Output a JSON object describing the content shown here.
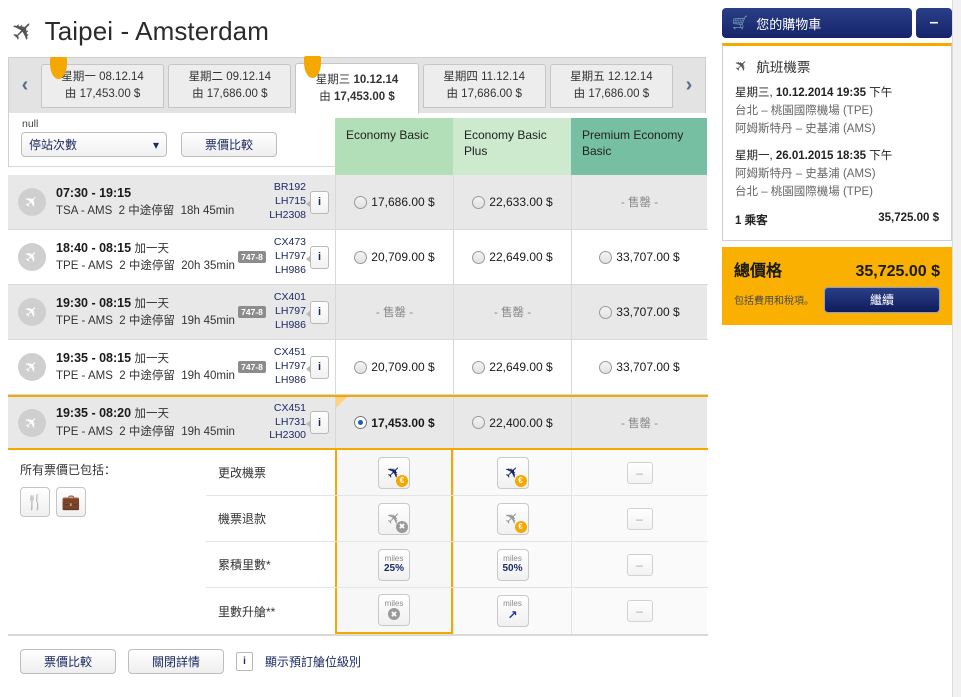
{
  "header": {
    "title": "Taipei - Amsterdam",
    "plane_icon": "airplane-icon"
  },
  "date_tabs": {
    "prev_label": "‹",
    "next_label": "›",
    "items": [
      {
        "day": "星期一",
        "date": "08.12.14",
        "price_prefix": "由",
        "price": "17,453.00 $",
        "flagged": true,
        "active": false
      },
      {
        "day": "星期二",
        "date": "09.12.14",
        "price_prefix": "由",
        "price": "17,686.00 $",
        "flagged": false,
        "active": false
      },
      {
        "day": "星期三",
        "date": "10.12.14",
        "price_prefix": "由",
        "price": "17,453.00 $",
        "flagged": true,
        "active": true
      },
      {
        "day": "星期四",
        "date": "11.12.14",
        "price_prefix": "由",
        "price": "17,686.00 $",
        "flagged": false,
        "active": false
      },
      {
        "day": "星期五",
        "date": "12.12.14",
        "price_prefix": "由",
        "price": "17,686.00 $",
        "flagged": false,
        "active": false
      }
    ]
  },
  "toolbar": {
    "select_caption": "null",
    "select_value": "停站次數",
    "compare_button": "票價比較"
  },
  "cabins": [
    {
      "name": "Economy Basic",
      "color": "#b3dfb8"
    },
    {
      "name": "Economy Basic Plus",
      "color": "#cdeacf"
    },
    {
      "name": "Premium Economy Basic",
      "color": "#76bfa3"
    }
  ],
  "sold_out_label": "- 售罄 -",
  "flights": [
    {
      "times": "07:30 - 19:15",
      "add_day": "",
      "route": "TSA - AMS",
      "stops": "2 中途停留",
      "duration": "18h 45min",
      "aircraft": "",
      "flight_numbers": [
        "BR192",
        "LH715",
        "LH2308"
      ],
      "info_label": "i",
      "prices": [
        "17,686.00 $",
        "22,633.00 $",
        null
      ],
      "selected_index": -1
    },
    {
      "times": "18:40 - 08:15",
      "add_day": "加一天",
      "route": "TPE - AMS",
      "stops": "2 中途停留",
      "duration": "20h 35min",
      "aircraft": "747-8",
      "flight_numbers": [
        "CX473",
        "LH797",
        "LH986"
      ],
      "info_label": "i",
      "prices": [
        "20,709.00 $",
        "22,649.00 $",
        "33,707.00 $"
      ],
      "selected_index": -1
    },
    {
      "times": "19:30 - 08:15",
      "add_day": "加一天",
      "route": "TPE - AMS",
      "stops": "2 中途停留",
      "duration": "19h 45min",
      "aircraft": "747-8",
      "flight_numbers": [
        "CX401",
        "LH797",
        "LH986"
      ],
      "info_label": "i",
      "prices": [
        null,
        null,
        "33,707.00 $"
      ],
      "selected_index": -1
    },
    {
      "times": "19:35 - 08:15",
      "add_day": "加一天",
      "route": "TPE - AMS",
      "stops": "2 中途停留",
      "duration": "19h 40min",
      "aircraft": "747-8",
      "flight_numbers": [
        "CX451",
        "LH797",
        "LH986"
      ],
      "info_label": "i",
      "prices": [
        "20,709.00 $",
        "22,649.00 $",
        "33,707.00 $"
      ],
      "selected_index": -1
    },
    {
      "times": "19:35 - 08:20",
      "add_day": "加一天",
      "route": "TPE - AMS",
      "stops": "2 中途停留",
      "duration": "19h 45min",
      "aircraft": "",
      "flight_numbers": [
        "CX451",
        "LH731",
        "LH2300"
      ],
      "info_label": "i",
      "prices": [
        "17,453.00 $",
        "22,400.00 $",
        null
      ],
      "selected_index": 0
    }
  ],
  "includes": {
    "title": "所有票價已包括：",
    "icons": [
      "meal-icon",
      "baggage-icon"
    ]
  },
  "features": [
    {
      "label": "更改機票",
      "cells": [
        {
          "kind": "plane-euro",
          "tone": "blue",
          "text": ""
        },
        {
          "kind": "plane-euro",
          "tone": "blue",
          "text": ""
        },
        {
          "kind": "dash",
          "tone": "",
          "text": "–"
        }
      ]
    },
    {
      "label": "機票退款",
      "cells": [
        {
          "kind": "plane-x",
          "tone": "grey",
          "text": ""
        },
        {
          "kind": "plane-euro",
          "tone": "grey",
          "text": ""
        },
        {
          "kind": "dash",
          "tone": "",
          "text": "–"
        }
      ]
    },
    {
      "label": "累積里數*",
      "cells": [
        {
          "kind": "miles-pct",
          "tone": "",
          "text": "25%"
        },
        {
          "kind": "miles-pct",
          "tone": "",
          "text": "50%"
        },
        {
          "kind": "dash",
          "tone": "",
          "text": "–"
        }
      ]
    },
    {
      "label": "里數升艙**",
      "cells": [
        {
          "kind": "miles-x",
          "tone": "",
          "text": ""
        },
        {
          "kind": "miles-arrow",
          "tone": "",
          "text": "↗"
        },
        {
          "kind": "dash",
          "tone": "",
          "text": "–"
        }
      ]
    }
  ],
  "miles_label": "miles",
  "footer": {
    "compare_button": "票價比較",
    "close_button": "關閉詳情",
    "info_label": "i",
    "info_text": "顯示預訂艙位級別"
  },
  "cart": {
    "title": "您的購物車",
    "cart_icon": "shopping-cart-icon",
    "minimize_label": "–",
    "section_title": "航班機票",
    "legs": [
      {
        "date_day": "星期三, ",
        "date_value": "10.12.2014 19:35",
        "date_suffix": " 下午",
        "from": "台北 – 桃園國際機場 (TPE)",
        "to": "阿姆斯特丹 – 史基浦 (AMS)"
      },
      {
        "date_day": "星期一, ",
        "date_value": "26.01.2015 18:35",
        "date_suffix": " 下午",
        "from": "阿姆斯特丹 – 史基浦 (AMS)",
        "to": "台北 – 桃園國際機場 (TPE)"
      }
    ],
    "pax_label": "1 乘客",
    "pax_price": "35,725.00 $",
    "total_label": "總價格",
    "total_amount": "35,725.00 $",
    "tax_note": "包括費用和稅項。",
    "continue_button": "繼續"
  },
  "colors": {
    "accent_orange": "#f9a800",
    "brand_navy": "#16246b",
    "cabin_1": "#b3dfb8",
    "cabin_2": "#cdeacf",
    "cabin_3": "#76bfa3"
  }
}
